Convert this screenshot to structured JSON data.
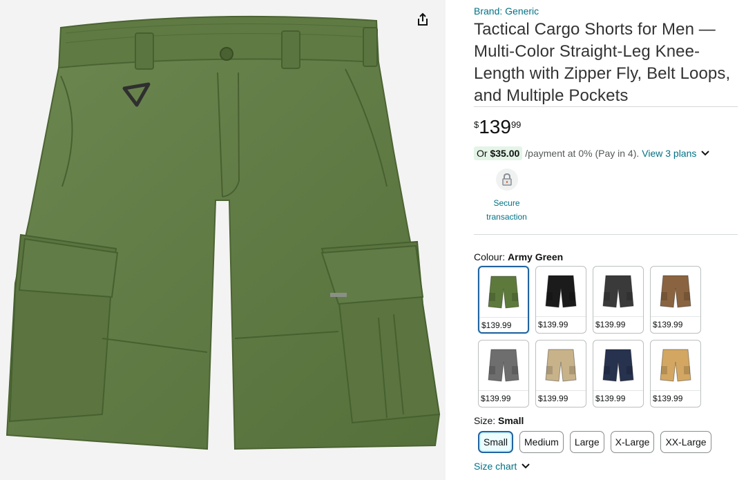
{
  "product": {
    "brand": "Brand: Generic",
    "title": "Tactical Cargo Shorts for Men — Multi-Color Straight-Leg Knee-Length with Zipper Fly, Belt Loops, and Multiple Pockets",
    "price": {
      "symbol": "$",
      "whole": "139",
      "fraction": "99"
    },
    "installment": {
      "or": "Or",
      "amount": "$35.00",
      "text": "/payment at 0% (Pay in 4).",
      "link": "View 3 plans"
    },
    "secure": "Secure transaction",
    "colour": {
      "label": "Colour:",
      "selected": "Army Green",
      "options": [
        {
          "color": "#5d7a3c",
          "price": "$139.99"
        },
        {
          "color": "#1b1b1b",
          "price": "$139.99"
        },
        {
          "color": "#3a3a3a",
          "price": "$139.99"
        },
        {
          "color": "#8a6440",
          "price": "$139.99"
        },
        {
          "color": "#6e6e6e",
          "price": "$139.99"
        },
        {
          "color": "#c8b28a",
          "price": "$139.99"
        },
        {
          "color": "#27324f",
          "price": "$139.99"
        },
        {
          "color": "#d3a762",
          "price": "$139.99"
        }
      ]
    },
    "size": {
      "label": "Size:",
      "selected": "Small",
      "options": [
        "Small",
        "Medium",
        "Large",
        "X-Large",
        "XX-Large"
      ],
      "chart_link": "Size chart"
    },
    "image": {
      "main_color": "#617a45"
    }
  }
}
